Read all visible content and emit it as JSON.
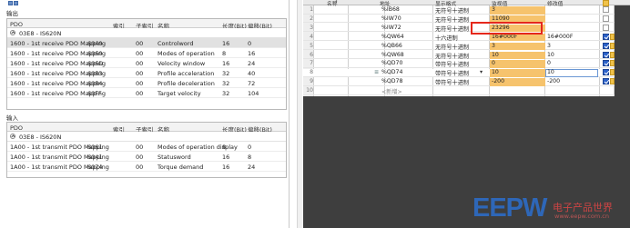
{
  "left": {
    "output_title": "输出",
    "input_title": "输入",
    "columns": [
      "PDO",
      "索引",
      "子索引",
      "名称",
      "长度(Bit)",
      "偏移(Bit)"
    ],
    "output_group": "03E8 - IS620N",
    "input_group": "03E8 - IS620N",
    "output_rows": [
      [
        "1600 - 1st receive PDO Mapping",
        "6040",
        "00",
        "Controlword",
        "16",
        "0"
      ],
      [
        "1600 - 1st receive PDO Mapping",
        "6060",
        "00",
        "Modes of operation",
        "8",
        "16"
      ],
      [
        "1600 - 1st receive PDO Mapping",
        "606D",
        "00",
        "Velocity window",
        "16",
        "24"
      ],
      [
        "1600 - 1st receive PDO Mapping",
        "6083",
        "00",
        "Profile acceleration",
        "32",
        "40"
      ],
      [
        "1600 - 1st receive PDO Mapping",
        "6084",
        "00",
        "Profile deceleration",
        "32",
        "72"
      ],
      [
        "1600 - 1st receive PDO Mapping",
        "60FF",
        "00",
        "Target velocity",
        "32",
        "104"
      ]
    ],
    "input_rows": [
      [
        "1A00 - 1st transmit PDO Mapping",
        "6061",
        "00",
        "Modes of operation display",
        "8",
        "0"
      ],
      [
        "1A00 - 1st transmit PDO Mapping",
        "6041",
        "00",
        "Statusword",
        "16",
        "8"
      ],
      [
        "1A00 - 1st transmit PDO Mapping",
        "6074",
        "00",
        "Torque demand",
        "16",
        "24"
      ]
    ]
  },
  "right": {
    "columns": [
      "名称",
      "地址",
      "显示格式",
      "监视值",
      "修改值"
    ],
    "rows": [
      {
        "n": "1",
        "addr": "%IB68",
        "fmt": "无符号十进制",
        "mon": "3",
        "mod": "",
        "chk": false
      },
      {
        "n": "2",
        "addr": "%IW70",
        "fmt": "无符号十进制",
        "mon": "11090",
        "mod": "",
        "chk": false
      },
      {
        "n": "3",
        "addr": "%IW72",
        "fmt": "无符号十进制",
        "mon": "23296",
        "mod": "",
        "chk": false
      },
      {
        "n": "4",
        "addr": "%QW64",
        "fmt": "十六进制",
        "mon": "16#000F",
        "mod": "16#000F",
        "chk": true
      },
      {
        "n": "5",
        "addr": "%QB66",
        "fmt": "无符号十进制",
        "mon": "3",
        "mod": "3",
        "chk": true
      },
      {
        "n": "6",
        "addr": "%QW68",
        "fmt": "无符号十进制",
        "mon": "10",
        "mod": "10",
        "chk": true
      },
      {
        "n": "7",
        "addr": "%QD70",
        "fmt": "带符号十进制",
        "mon": "0",
        "mod": "0",
        "chk": true
      },
      {
        "n": "8",
        "addr": "%QD74",
        "fmt": "带符号十进制",
        "mon": "10",
        "mod": "10",
        "chk": true
      },
      {
        "n": "9",
        "addr": "%QD78",
        "fmt": "带符号十进制",
        "mon": "-200",
        "mod": "-200",
        "chk": true
      },
      {
        "n": "10",
        "addr": "<新增>",
        "fmt": "",
        "mon": "",
        "mod": "",
        "chk": null
      }
    ]
  },
  "logo": {
    "brand": "EEPW",
    "cn": "电子产品世界",
    "url": "www.eepw.com.cn"
  }
}
